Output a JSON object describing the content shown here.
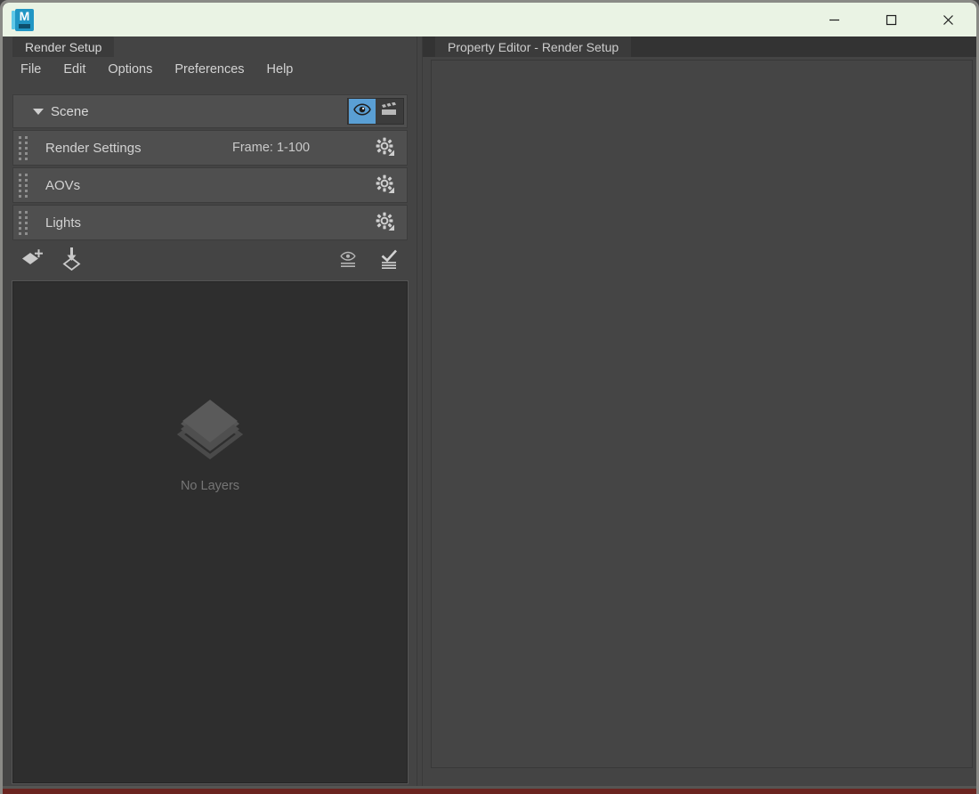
{
  "window": {
    "app_icon": "maya-logo-icon",
    "app_icon_letter": "M",
    "minimize_label": "minimize-icon",
    "maximize_label": "maximize-icon",
    "close_label": "close-icon"
  },
  "left_panel": {
    "tab_label": "Render Setup",
    "menubar": [
      {
        "label": "File"
      },
      {
        "label": "Edit"
      },
      {
        "label": "Options"
      },
      {
        "label": "Preferences"
      },
      {
        "label": "Help"
      }
    ],
    "scene_row": {
      "label": "Scene",
      "expanded": true,
      "visibility_icon": "eye-icon",
      "visibility_active": true,
      "render_icon": "clapperboard-icon"
    },
    "collections": [
      {
        "name": "Render Settings",
        "detail": "Frame: 1-100",
        "gear_icon": "gear-icon"
      },
      {
        "name": "AOVs",
        "detail": "",
        "gear_icon": "gear-icon"
      },
      {
        "name": "Lights",
        "detail": "",
        "gear_icon": "gear-icon"
      }
    ],
    "toolbar": {
      "create_layer_icon": "create-layer-icon",
      "import_layer_icon": "import-layer-icon",
      "visible_filter_icon": "visible-layers-filter-icon",
      "enabled_filter_icon": "enabled-layers-filter-icon"
    },
    "layer_list": {
      "empty_icon": "layers-stack-icon",
      "empty_text": "No Layers"
    }
  },
  "right_panel": {
    "tab_label": "Property Editor - Render Setup"
  },
  "colors": {
    "titlebar_bg": "#eaf3e4",
    "panel_bg": "#444444",
    "row_bg": "#4f4f4f",
    "list_bg": "#2e2e2e",
    "accent_blue": "#5a9fd4",
    "text": "#d2d2d2",
    "muted_text": "#757575"
  }
}
